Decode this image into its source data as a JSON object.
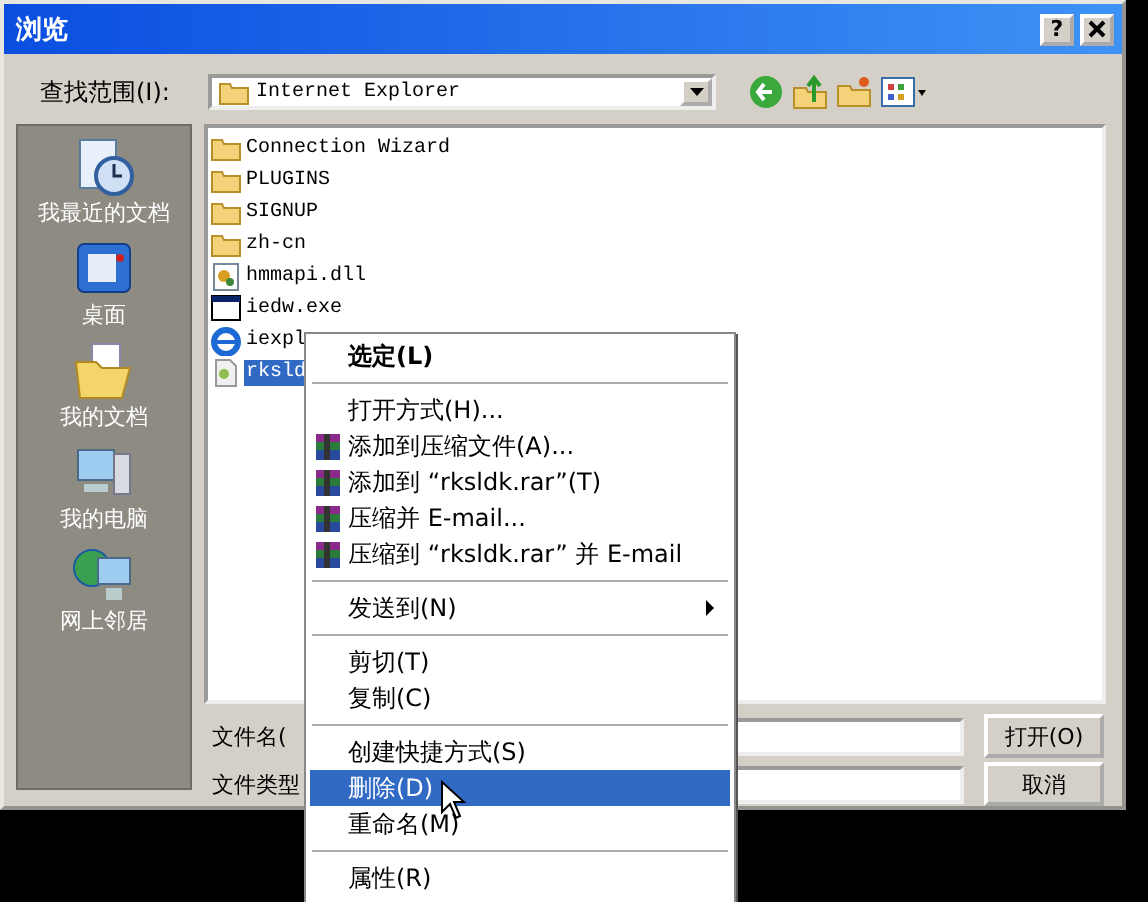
{
  "window": {
    "title": "浏览",
    "help_button": "?"
  },
  "look_in": {
    "label": "查找范围(I):",
    "value": "Internet Explorer"
  },
  "places": [
    {
      "kind": "recent",
      "label": "我最近的文档"
    },
    {
      "kind": "desktop",
      "label": "桌面"
    },
    {
      "kind": "documents",
      "label": "我的文档"
    },
    {
      "kind": "computer",
      "label": "我的电脑"
    },
    {
      "kind": "network",
      "label": "网上邻居"
    }
  ],
  "files": [
    {
      "kind": "folder",
      "name": "Connection Wizard",
      "selected": false
    },
    {
      "kind": "folder",
      "name": "PLUGINS",
      "selected": false
    },
    {
      "kind": "folder",
      "name": "SIGNUP",
      "selected": false
    },
    {
      "kind": "folder",
      "name": "zh-cn",
      "selected": false
    },
    {
      "kind": "dll",
      "name": "hmmapi.dll",
      "selected": false
    },
    {
      "kind": "exe",
      "name": "iedw.exe",
      "selected": false
    },
    {
      "kind": "ie",
      "name": "iexpl",
      "selected": false
    },
    {
      "kind": "file",
      "name": "rksld",
      "selected": true
    }
  ],
  "file_name": {
    "label": "文件名("
  },
  "file_type": {
    "label": "文件类型"
  },
  "buttons": [
    {
      "label": "打开(O)"
    },
    {
      "label": "取消"
    }
  ],
  "context_menu": {
    "groups": [
      [
        {
          "kind": "default",
          "label": "选定(L)",
          "selected": false
        }
      ],
      [
        {
          "kind": "plain",
          "label": "打开方式(H)...",
          "selected": false
        },
        {
          "kind": "archive",
          "label": "添加到压缩文件(A)...",
          "selected": false
        },
        {
          "kind": "archive",
          "label": "添加到 “rksldk.rar”(T)",
          "selected": false
        },
        {
          "kind": "archive",
          "label": "压缩并 E-mail...",
          "selected": false
        },
        {
          "kind": "archive",
          "label": "压缩到 “rksldk.rar” 并 E-mail",
          "selected": false
        }
      ],
      [
        {
          "kind": "submenu",
          "label": "发送到(N)",
          "selected": false
        }
      ],
      [
        {
          "kind": "plain",
          "label": "剪切(T)",
          "selected": false
        },
        {
          "kind": "plain",
          "label": "复制(C)",
          "selected": false
        }
      ],
      [
        {
          "kind": "plain",
          "label": "创建快捷方式(S)",
          "selected": false
        },
        {
          "kind": "plain",
          "label": "删除(D)",
          "selected": true
        },
        {
          "kind": "plain",
          "label": "重命名(M)",
          "selected": false
        }
      ],
      [
        {
          "kind": "plain",
          "label": "属性(R)",
          "selected": false
        }
      ]
    ]
  }
}
